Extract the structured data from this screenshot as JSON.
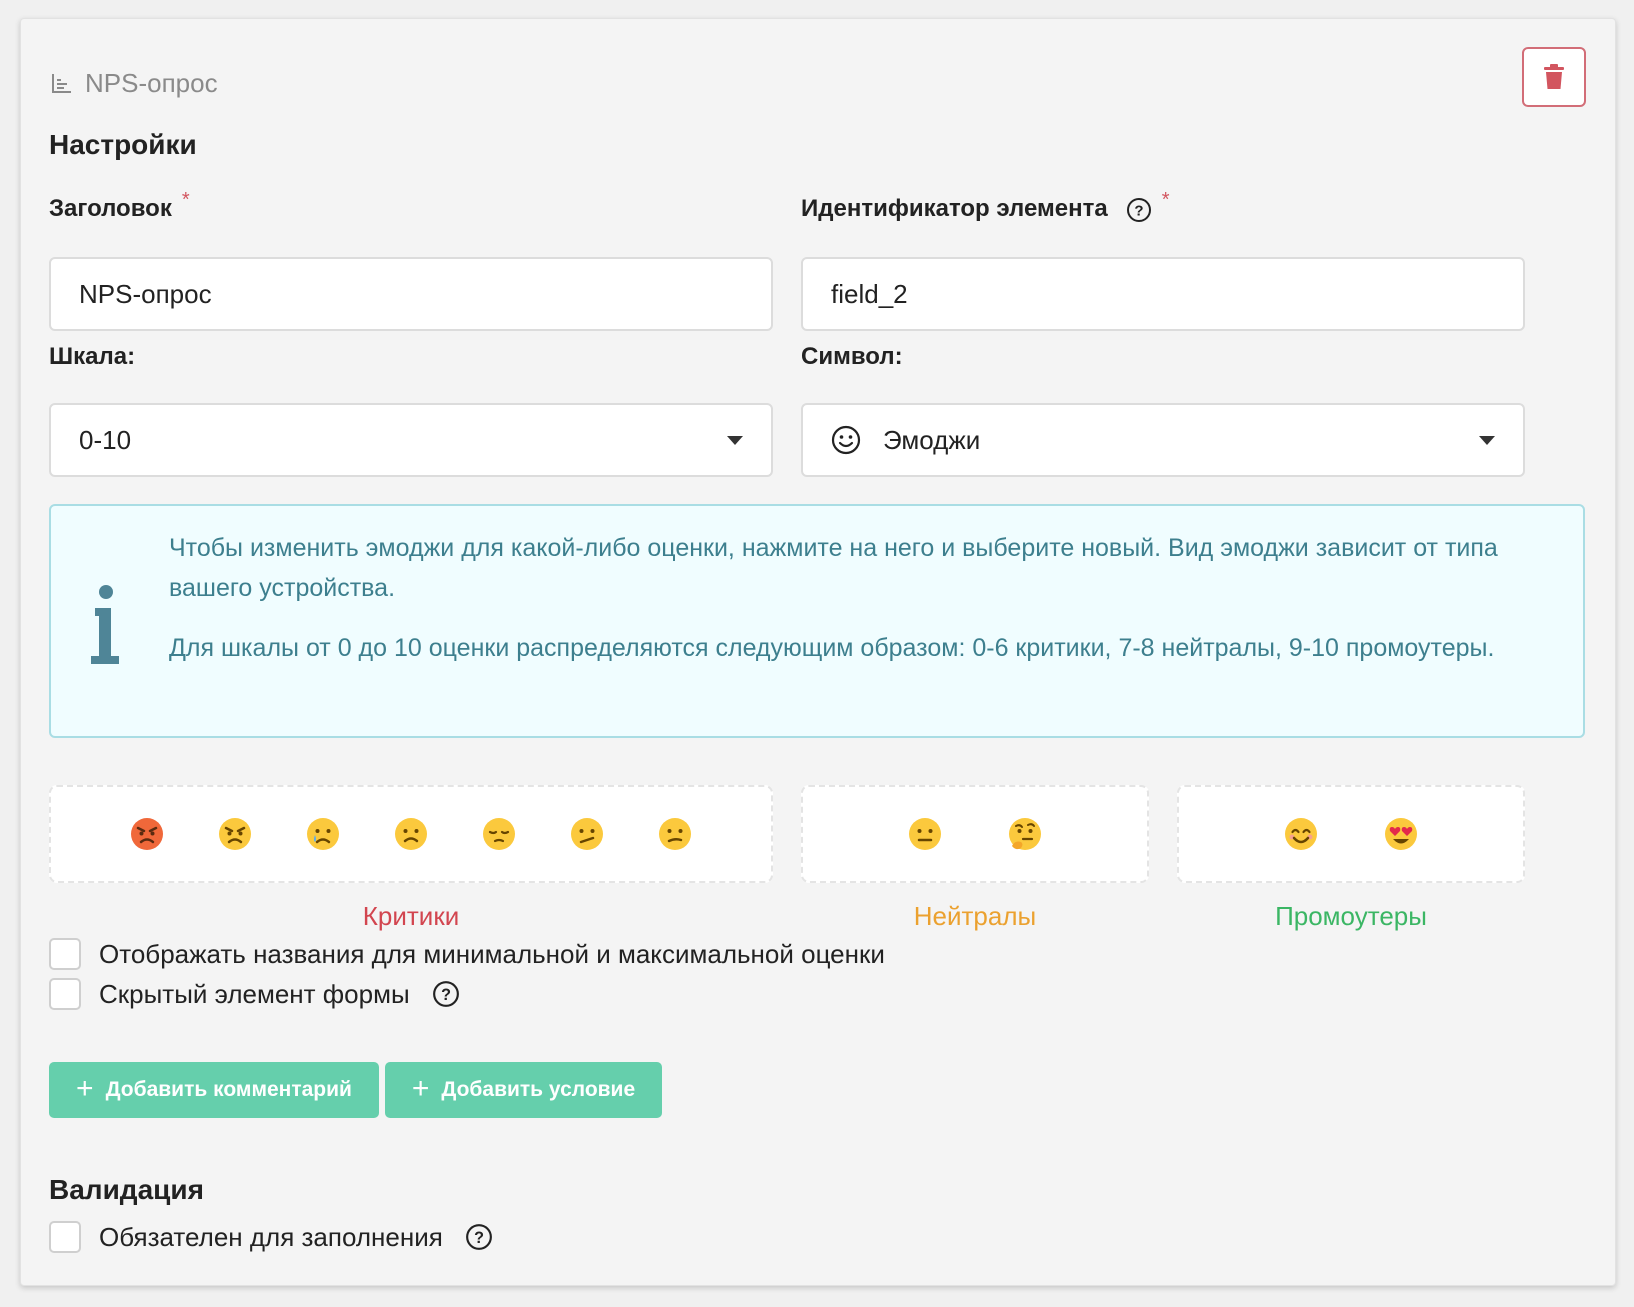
{
  "header": {
    "title": "NPS-опрос",
    "icon": "chart-icon",
    "delete_icon": "trash-icon"
  },
  "settings": {
    "section_title": "Настройки",
    "title_field": {
      "label": "Заголовок",
      "required_mark": "*",
      "value": "NPS-опрос"
    },
    "id_field": {
      "label": "Идентификатор элемента",
      "required_mark": "*",
      "value": "field_2"
    },
    "scale_field": {
      "label": "Шкала:",
      "value": "0-10"
    },
    "symbol_field": {
      "label": "Символ:",
      "value": "Эмоджи",
      "icon": "smiley-icon"
    }
  },
  "info": {
    "paragraph1": "Чтобы изменить эмоджи для какой-либо оценки, нажмите на него и выберите новый. Вид эмоджи зависит от типа вашего устройства.",
    "paragraph2": "Для шкалы от 0 до 10 оценки распределяются следующим образом: 0-6 критики, 7-8 нейтралы, 9-10 промоутеры."
  },
  "groups": {
    "critics": {
      "label": "Критики",
      "color": "#d2454f",
      "emojis": [
        "angry",
        "pouting",
        "crying",
        "frowning",
        "pensive",
        "confused",
        "slight-confused"
      ]
    },
    "neutrals": {
      "label": "Нейтралы",
      "color": "#eba12f",
      "emojis": [
        "neutral",
        "thinking"
      ]
    },
    "promoters": {
      "label": "Промоутеры",
      "color": "#3bb664",
      "emojis": [
        "smiling",
        "heart-eyes"
      ]
    }
  },
  "options": {
    "show_names": {
      "label": "Отображать названия для минимальной и максимальной оценки",
      "checked": false
    },
    "hidden_element": {
      "label": "Скрытый элемент формы",
      "checked": false
    }
  },
  "buttons": {
    "add_comment": "Добавить комментарий",
    "add_condition": "Добавить условие",
    "plus": "+"
  },
  "validation": {
    "section_title": "Валидация",
    "required": {
      "label": "Обязателен для заполнения",
      "checked": false
    }
  },
  "colors": {
    "accent": "#65cfac",
    "danger": "#d26d77",
    "info_text": "#3d7f8e",
    "info_bg": "#f0fdff"
  }
}
